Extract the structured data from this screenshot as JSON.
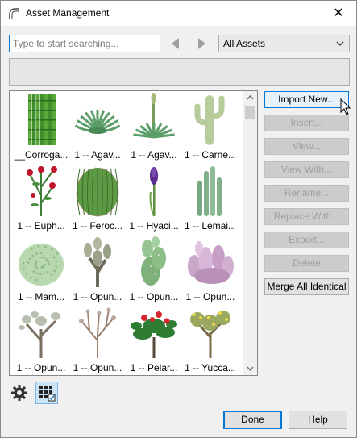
{
  "window": {
    "title": "Asset Management",
    "close_glyph": "✕"
  },
  "search": {
    "placeholder": "Type to start searching...",
    "value": ""
  },
  "filter": {
    "selected": "All Assets"
  },
  "assets": [
    {
      "label": "__Corroga...",
      "icon": "bamboo-fence-icon"
    },
    {
      "label": "1 -- Agav...",
      "icon": "agave-icon"
    },
    {
      "label": "1 -- Agav...",
      "icon": "agave-flowering-icon"
    },
    {
      "label": "1 -- Carne...",
      "icon": "carnegiea-cactus-icon"
    },
    {
      "label": "1 -- Euph...",
      "icon": "euphorbia-icon"
    },
    {
      "label": "1 -- Feroc...",
      "icon": "ferocactus-icon"
    },
    {
      "label": "1 -- Hyaci...",
      "icon": "hyacinth-icon"
    },
    {
      "label": "1 -- Lemai...",
      "icon": "lemaireocereus-icon"
    },
    {
      "label": "1 -- Mam...",
      "icon": "mammillaria-icon"
    },
    {
      "label": "1 -- Opun...",
      "icon": "opuntia-icon"
    },
    {
      "label": "1 -- Opun...",
      "icon": "opuntia-pad-icon"
    },
    {
      "label": "1 -- Opun...",
      "icon": "opuntia-purple-icon"
    },
    {
      "label": "1 -- Opun...",
      "icon": "opuntia-tree-icon"
    },
    {
      "label": "1 -- Opun...",
      "icon": "opuntia-branch-icon"
    },
    {
      "label": "1 -- Pelar...",
      "icon": "pelargonium-icon"
    },
    {
      "label": "1 -- Yucca...",
      "icon": "yucca-tree-icon"
    }
  ],
  "actions": [
    {
      "name": "import-new-button",
      "label": "Import New...",
      "enabled": true,
      "primary": true
    },
    {
      "name": "insert-button",
      "label": "Insert...",
      "enabled": false
    },
    {
      "name": "view-button",
      "label": "View...",
      "enabled": false
    },
    {
      "name": "view-with-button",
      "label": "View With...",
      "enabled": false
    },
    {
      "name": "rename-button",
      "label": "Rename...",
      "enabled": false
    },
    {
      "name": "replace-with-button",
      "label": "Replace With...",
      "enabled": false
    },
    {
      "name": "export-button",
      "label": "Export...",
      "enabled": false
    },
    {
      "name": "delete-button",
      "label": "Delete",
      "enabled": false
    },
    {
      "name": "merge-all-identical-button",
      "label": "Merge All Identical",
      "enabled": true
    }
  ],
  "footer": {
    "done_label": "Done",
    "help_label": "Help"
  },
  "colors": {
    "accent": "#0078d7",
    "disabled_text": "#a0a0a0"
  }
}
